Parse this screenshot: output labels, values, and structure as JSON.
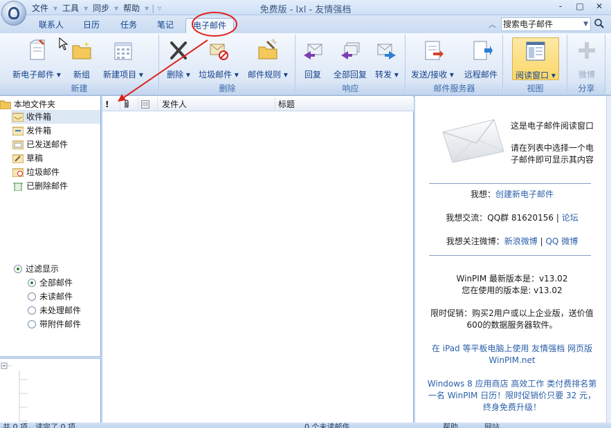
{
  "titlebar": {
    "title": "免费版 - lxl - 友情强档",
    "menu": [
      "文件",
      "工具",
      "同步",
      "帮助"
    ],
    "window_controls": [
      "-",
      "□",
      "✕"
    ]
  },
  "tabs": [
    {
      "label": "联系人"
    },
    {
      "label": "日历"
    },
    {
      "label": "任务"
    },
    {
      "label": "笔记"
    },
    {
      "label": "电子邮件"
    }
  ],
  "search": {
    "value": "搜索电子邮件"
  },
  "ribbon": {
    "groups": [
      {
        "label": "新建",
        "buttons": [
          "新电子邮件 ▾",
          "新组",
          "新建项目 ▾"
        ]
      },
      {
        "label": "删除",
        "buttons": [
          "删除 ▾",
          "垃圾邮件 ▾",
          "邮件规则 ▾"
        ]
      },
      {
        "label": "响应",
        "buttons": [
          "回复",
          "全部回复",
          "转发 ▾"
        ]
      },
      {
        "label": "邮件服务器",
        "buttons": [
          "发送/接收 ▾",
          "远程邮件"
        ]
      },
      {
        "label": "视图",
        "buttons": [
          "阅读窗口 ▾"
        ]
      },
      {
        "label": "分享",
        "buttons": [
          "微博"
        ]
      }
    ]
  },
  "folders": {
    "root": "本地文件夹",
    "items": [
      "收件箱",
      "发件箱",
      "已发送邮件",
      "草稿",
      "垃圾邮件",
      "已删除邮件"
    ]
  },
  "filter": {
    "title": "过滤显示",
    "options": [
      "全部邮件",
      "未读邮件",
      "未处理邮件",
      "带附件邮件"
    ],
    "selected": "全部邮件"
  },
  "list": {
    "columns": [
      "!",
      "0",
      "",
      "发件人",
      "标题"
    ]
  },
  "reading": {
    "intro_title": "这是电子邮件阅读窗口",
    "intro_body_1": "请在列表中选择一个电",
    "intro_body_2": "子邮件即可显示其内容",
    "want_label": "我想：",
    "want_link": "创建新电子邮件",
    "chat_label": "我想交流：QQ群 81620156 | ",
    "chat_link": "论坛",
    "follow_label": "我想关注微博：",
    "follow_link1": "新浪微博",
    "follow_sep": " | ",
    "follow_link2": "QQ 微博",
    "latest_version": "WinPIM 最新版本是：v13.02",
    "current_version": "您在使用的版本是: v13.02",
    "promo_1": "限时促销：购买2用户或以上企业版，送价值",
    "promo_2": "600的数据服务器软件。",
    "ipad_1": "在 iPad 等平板电脑上使用 友情强档 网页版",
    "ipad_2": "WinPIM.net",
    "store_1": "Windows 8 应用商店 高效工作 类付费排名第",
    "store_2": "一名 WinPIM 日历！限时促销价只要 32 元，",
    "store_3": "终身免费升级！"
  },
  "statusbar": {
    "left": "共 0 项，读完了 0 项",
    "right1": "0 个未读邮件",
    "right2": "帮助",
    "right3": "网站"
  },
  "colors": {
    "accent": "#15428b",
    "annotation": "#e0201b",
    "ribbon_label": "#3e6aaa",
    "link": "#2a5fa8"
  }
}
